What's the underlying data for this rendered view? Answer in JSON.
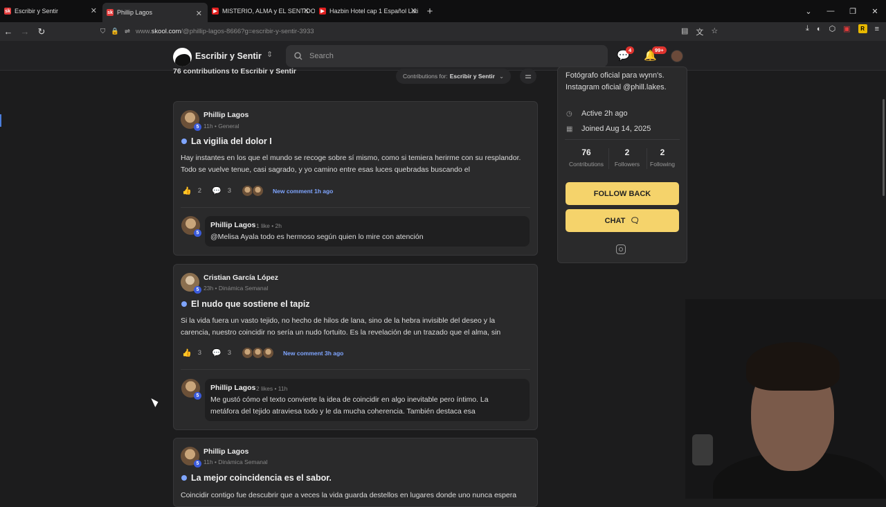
{
  "browser": {
    "tabs": [
      {
        "label": "Escribir y Sentir",
        "fav": "sk",
        "color": "#e23a3a"
      },
      {
        "label": "Phillip Lagos",
        "fav": "sk",
        "color": "#e23a3a"
      },
      {
        "label": "MISTERIO, ALMA y EL SENTIDO",
        "fav": "▶",
        "color": "#e02020"
      },
      {
        "label": "Hazbin Hotel cap 1 Español Lati",
        "fav": "▶",
        "color": "#e02020"
      }
    ],
    "url_prefix": "www.",
    "url_domain": "skool.com",
    "url_path": "/@phillip-lagos-8666?g=escribir-y-sentir-3933"
  },
  "header": {
    "community": "Escribir y Sentir",
    "search_placeholder": "Search",
    "chat_badge": "4",
    "notif_badge": "99+"
  },
  "main": {
    "contributions_heading": "76 contributions to Escribir y Sentir",
    "filter_label": "Contributions for:",
    "filter_value": "Escribir y Sentir",
    "posts": [
      {
        "author": "Phillip Lagos",
        "level": "5",
        "time": "11h • General",
        "title": "La vigilia del dolor I",
        "body": "Hay instantes en los que el mundo se recoge sobre sí mismo, como si temiera herirme con su resplandor. Todo se vuelve tenue, casi sagrado, y yo camino entre esas luces quebradas buscando el",
        "likes": "2",
        "comments": "3",
        "new_comment": "New comment 1h ago",
        "reply": {
          "author": "Phillip Lagos",
          "level": "5",
          "meta": "1 like • 2h",
          "text": "@Melisa Ayala todo es hermoso según quien lo mire con atención"
        }
      },
      {
        "author": "Cristian García López",
        "level": "5",
        "time": "23h • Dinámica Semanal",
        "title": "El nudo que sostiene el tapiz",
        "body": "Si la vida fuera un vasto tejido, no hecho de hilos de lana, sino de la hebra invisible del deseo y la carencia, nuestro coincidir no sería un nudo fortuito. Es la revelación de un trazado que el alma, sin",
        "likes": "3",
        "comments": "3",
        "new_comment": "New comment 3h ago",
        "reply": {
          "author": "Phillip Lagos",
          "level": "5",
          "meta": "2 likes • 11h",
          "text": "Me gustó cómo el texto convierte la idea de coincidir en algo inevitable pero íntimo. La metáfora del tejido atraviesa todo y le da mucha coherencia. También destaca esa"
        }
      },
      {
        "author": "Phillip Lagos",
        "level": "5",
        "time": "11h • Dinámica Semanal",
        "title": "La mejor coincidencia es el sabor.",
        "body": "Coincidir contigo fue descubrir que a veces la vida guarda destellos en lugares donde uno nunca espera"
      }
    ]
  },
  "sidebar": {
    "bio": [
      "Fotógrafo oficial para wynn's.",
      "Instagram oficial @phill.lakes."
    ],
    "active": "Active 2h ago",
    "joined": "Joined Aug 14, 2025",
    "stats": [
      {
        "n": "76",
        "l": "Contributions"
      },
      {
        "n": "2",
        "l": "Followers"
      },
      {
        "n": "2",
        "l": "Following"
      }
    ],
    "follow_label": "FOLLOW BACK",
    "chat_label": "CHAT"
  }
}
